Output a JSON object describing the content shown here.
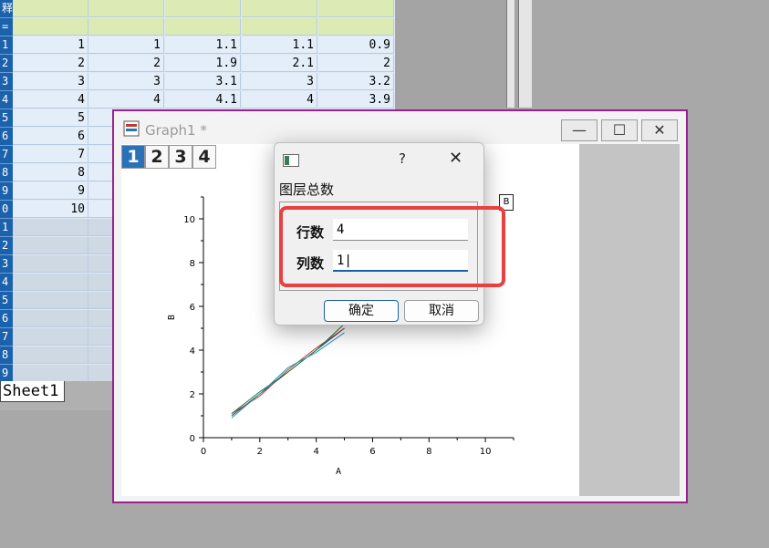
{
  "worksheet": {
    "meta_rows": [
      {
        "header": "释",
        "cells": [
          "",
          "",
          "",
          "",
          ""
        ]
      },
      {
        "header": "=",
        "cells": [
          "",
          "",
          "",
          "",
          ""
        ]
      }
    ],
    "data_rows": [
      {
        "header": "1",
        "cells": [
          "1",
          "1",
          "1.1",
          "1.1",
          "0.9"
        ]
      },
      {
        "header": "2",
        "cells": [
          "2",
          "2",
          "1.9",
          "2.1",
          "2"
        ]
      },
      {
        "header": "3",
        "cells": [
          "3",
          "3",
          "3.1",
          "3",
          "3.2"
        ]
      },
      {
        "header": "4",
        "cells": [
          "4",
          "4",
          "4.1",
          "4",
          "3.9"
        ]
      },
      {
        "header": "5",
        "cells": [
          "5",
          "",
          "",
          "",
          ""
        ]
      },
      {
        "header": "6",
        "cells": [
          "6",
          "",
          "",
          "",
          ""
        ]
      },
      {
        "header": "7",
        "cells": [
          "7",
          "",
          "",
          "",
          ""
        ]
      },
      {
        "header": "8",
        "cells": [
          "8",
          "",
          "",
          "",
          ""
        ]
      },
      {
        "header": "9",
        "cells": [
          "9",
          "",
          "",
          "",
          ""
        ]
      },
      {
        "header": "0",
        "cells": [
          "10",
          "",
          "",
          "",
          ""
        ]
      }
    ],
    "empty_rows": [
      "1",
      "2",
      "3",
      "4",
      "5",
      "6",
      "7",
      "8",
      "9"
    ],
    "sheet_tab": "Sheet1"
  },
  "graph_window": {
    "title": "Graph1 *",
    "layer_tabs": [
      "1",
      "2",
      "3",
      "4"
    ],
    "active_layer": "1",
    "legend_stub": "B",
    "buttons": {
      "minimize": "—",
      "maximize": "☐",
      "close": "✕"
    }
  },
  "chart_data": {
    "type": "line",
    "xlabel": "A",
    "ylabel": "B",
    "xlim": [
      0,
      11
    ],
    "ylim": [
      0,
      11
    ],
    "xticks": [
      "0",
      "2",
      "4",
      "6",
      "8",
      "10"
    ],
    "yticks": [
      "0",
      "2",
      "4",
      "6",
      "8",
      "10"
    ],
    "series": [
      {
        "color": "#2b3a8c",
        "x": [
          1,
          2,
          3,
          4,
          5
        ],
        "y": [
          1,
          2,
          3,
          4,
          5
        ]
      },
      {
        "color": "#c0392b",
        "x": [
          1,
          2,
          3,
          4,
          5
        ],
        "y": [
          1.1,
          1.9,
          3.1,
          4.1,
          5.0
        ]
      },
      {
        "color": "#1f7a3a",
        "x": [
          1,
          2,
          3,
          4,
          5
        ],
        "y": [
          1.1,
          2.1,
          3.0,
          4.0,
          5.2
        ]
      },
      {
        "color": "#1a9bb0",
        "x": [
          1,
          2,
          3,
          4,
          5
        ],
        "y": [
          0.9,
          2.0,
          3.2,
          3.9,
          4.8
        ]
      }
    ]
  },
  "dialog": {
    "help": "?",
    "close": "✕",
    "group_label": "图层总数",
    "rows_label": "行数",
    "rows_value": "4",
    "cols_label": "列数",
    "cols_value": "1|",
    "ok_label": "确定",
    "cancel_label": "取消",
    "highlight_color": "#e8413f"
  }
}
